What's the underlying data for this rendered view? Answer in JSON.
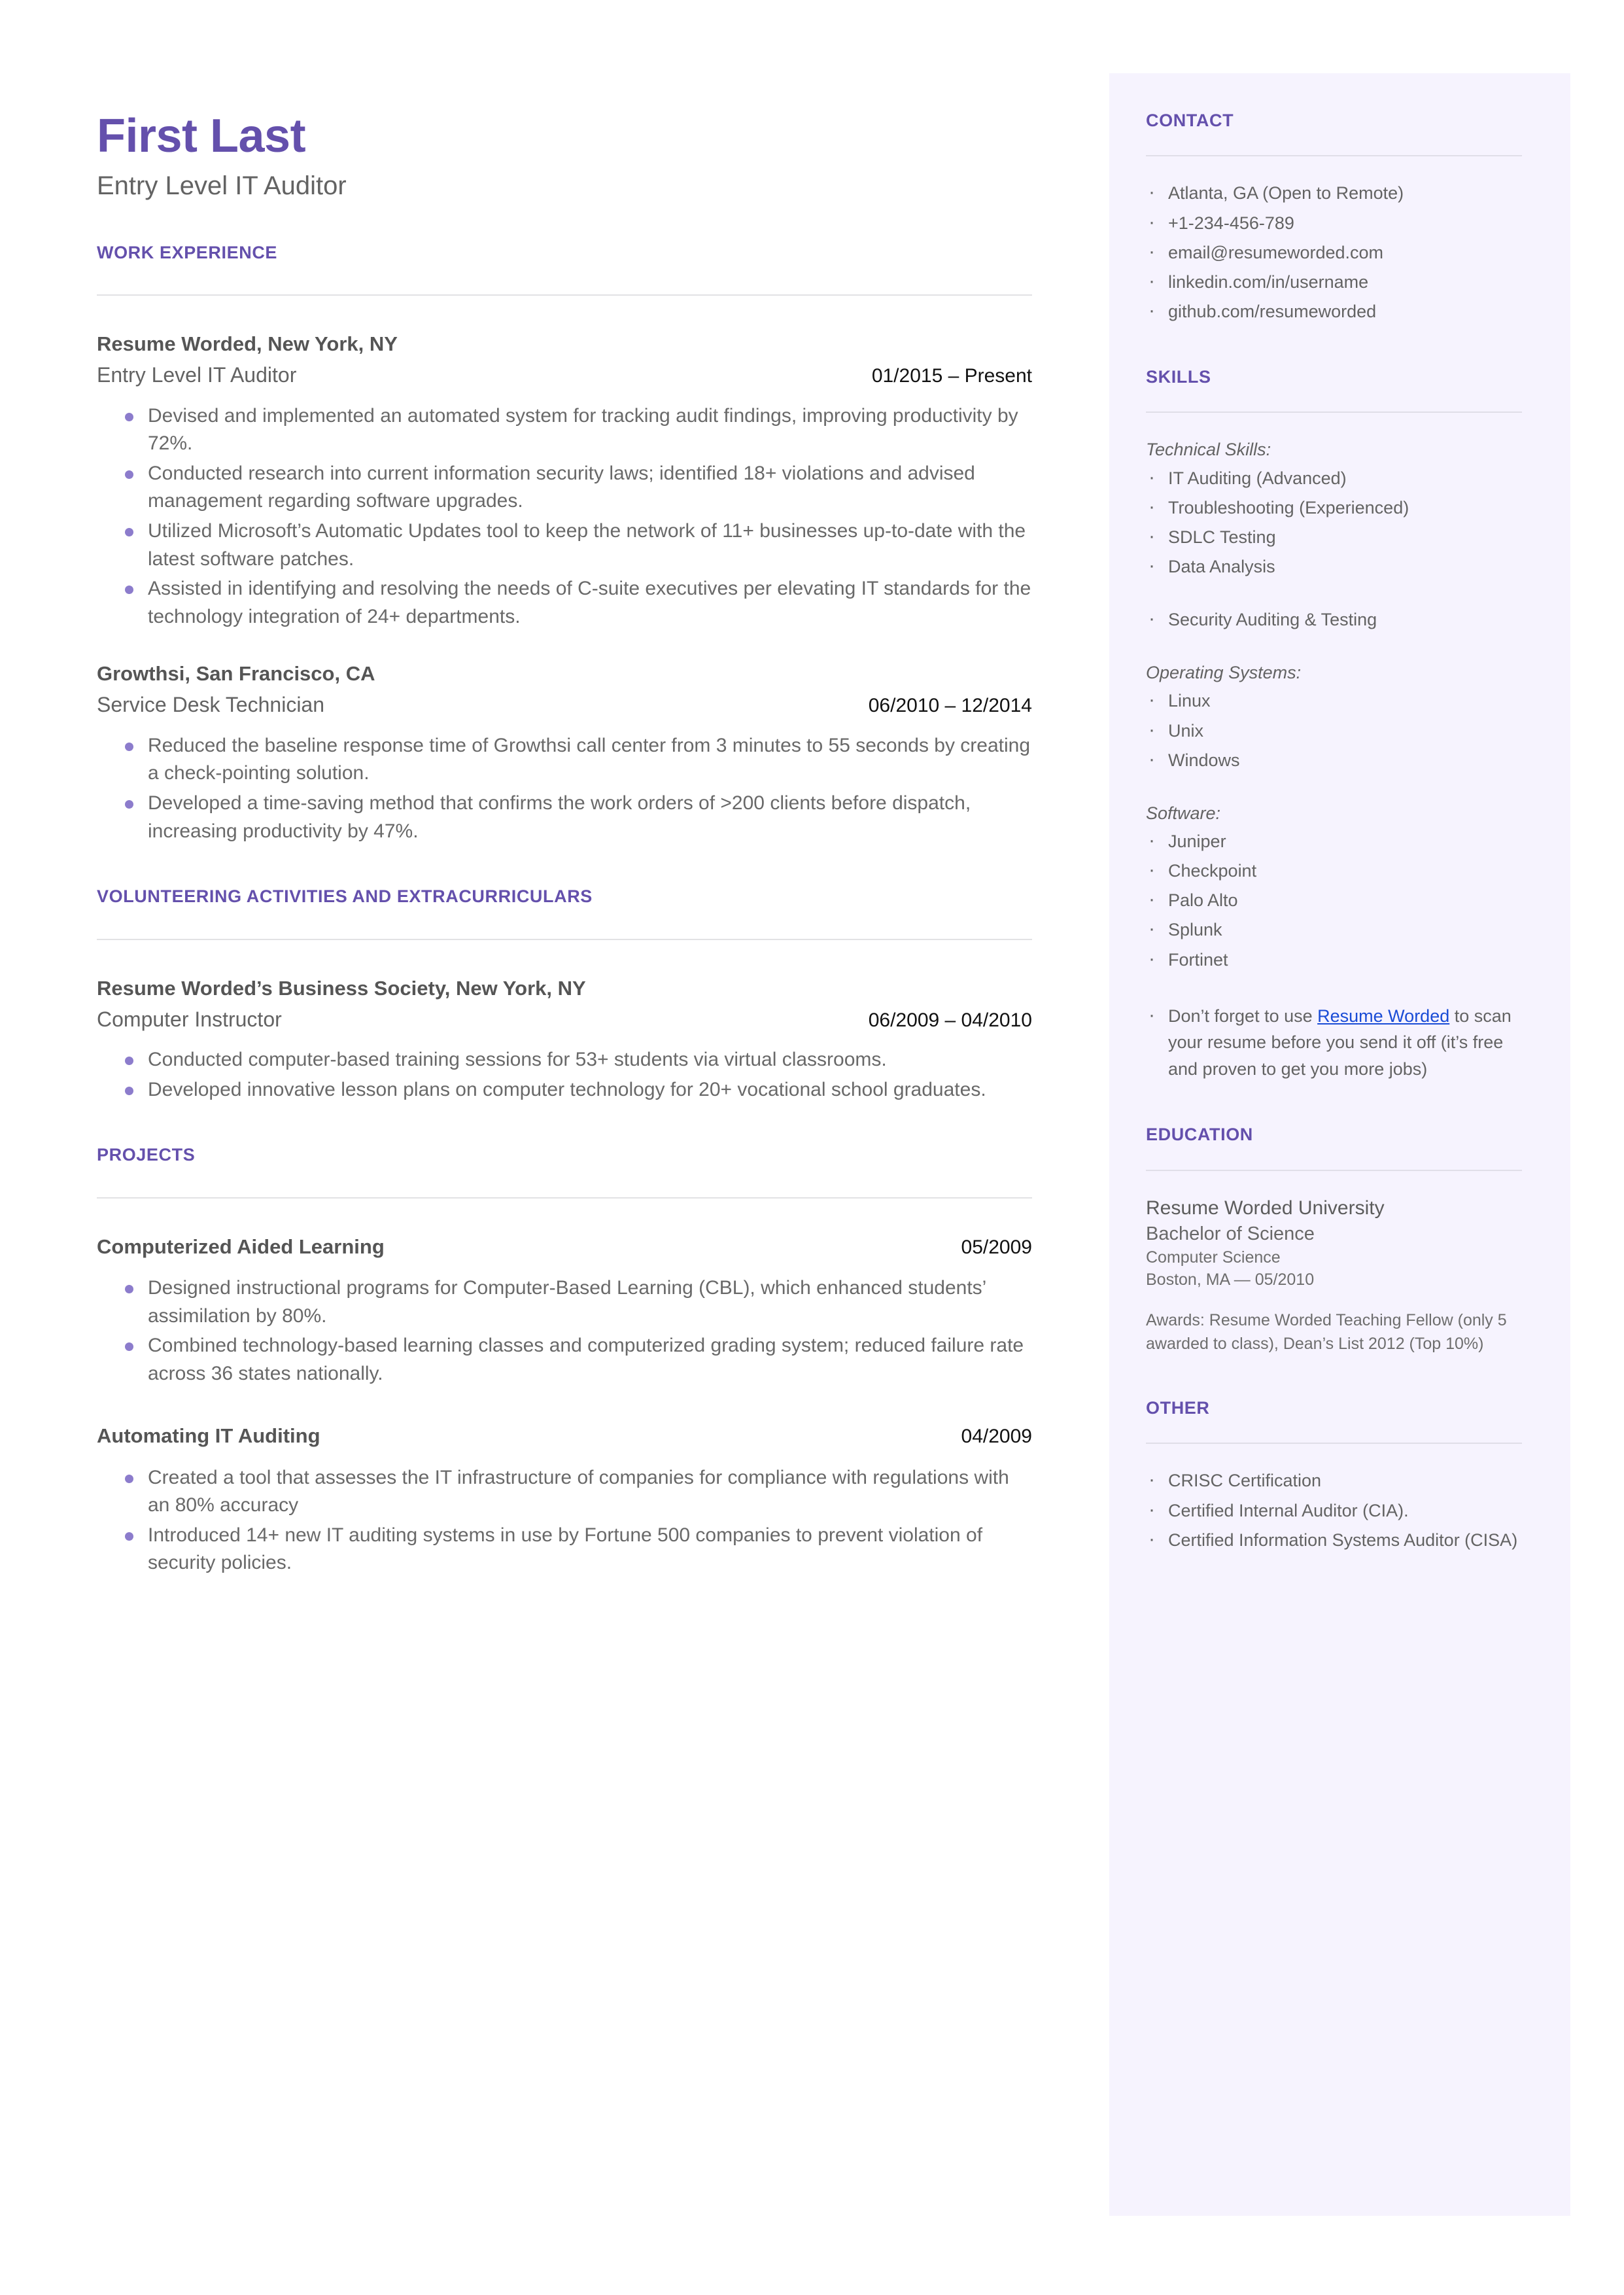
{
  "colors": {
    "accent_purple": "#6450ac",
    "bullet_purple": "#8c7ccc",
    "sidebar_bg": "#f6f3fe",
    "body_text": "#696969",
    "link_blue": "#1a4cd6"
  },
  "header": {
    "name": "First Last",
    "headline": "Entry Level IT Auditor"
  },
  "sections": {
    "work_experience": {
      "title": "WORK EXPERIENCE",
      "entries": [
        {
          "org": "Resume Worded, New York, NY",
          "role": "Entry Level IT Auditor",
          "dates": "01/2015 – Present",
          "bullets": [
            "Devised and implemented an automated system for tracking audit findings, improving productivity by 72%.",
            "Conducted research into current information security laws; identified 18+ violations and advised management regarding software upgrades.",
            "Utilized Microsoft’s Automatic Updates tool to keep the network of 11+ businesses up-to-date with the latest software patches.",
            "Assisted in identifying and resolving the needs of C-suite executives per elevating IT standards for the technology integration of 24+ departments."
          ]
        },
        {
          "org": "Growthsi, San Francisco, CA",
          "role": "Service Desk Technician",
          "dates": "06/2010 – 12/2014",
          "bullets": [
            "Reduced the baseline response time of Growthsi call center from 3 minutes to 55 seconds by creating a check-pointing solution.",
            "Developed a time-saving method that confirms the work orders of >200 clients before dispatch, increasing productivity by 47%."
          ]
        }
      ]
    },
    "volunteering": {
      "title": "VOLUNTEERING ACTIVITIES AND EXTRACURRICULARS",
      "entries": [
        {
          "org": "Resume Worded’s Business Society, New York, NY",
          "role": "Computer Instructor",
          "dates": "06/2009 – 04/2010",
          "bullets": [
            "Conducted computer-based training sessions for 53+ students via virtual classrooms.",
            "Developed innovative lesson plans on computer technology for 20+ vocational school graduates."
          ]
        }
      ]
    },
    "projects": {
      "title": "PROJECTS",
      "entries": [
        {
          "title": "Computerized Aided Learning",
          "date": "05/2009",
          "bullets": [
            "Designed instructional programs for Computer-Based Learning (CBL), which enhanced students’ assimilation by 80%.",
            "Combined technology-based learning classes and computerized grading system; reduced failure rate across 36 states nationally."
          ]
        },
        {
          "title": "Automating IT Auditing",
          "date": "04/2009",
          "bullets": [
            "Created a tool that assesses the IT infrastructure of companies for compliance with regulations with an 80% accuracy",
            "Introduced 14+ new IT auditing systems in use by Fortune 500 companies to prevent violation of security policies."
          ]
        }
      ]
    }
  },
  "sidebar": {
    "contact": {
      "title": "CONTACT",
      "items": [
        "Atlanta, GA (Open to Remote)",
        "+1-234-456-789",
        "email@resumeworded.com",
        "linkedin.com/in/username",
        "github.com/resumeworded"
      ]
    },
    "skills": {
      "title": "SKILLS",
      "groups": [
        {
          "label": "Technical Skills:",
          "items": [
            "IT Auditing (Advanced)",
            "Troubleshooting (Experienced)",
            "SDLC Testing",
            "Data Analysis"
          ]
        },
        {
          "label": "",
          "items": [
            "Security Auditing & Testing"
          ]
        },
        {
          "label": "Operating Systems:",
          "items": [
            "Linux",
            "Unix",
            "Windows"
          ]
        },
        {
          "label": "Software:",
          "items": [
            "Juniper",
            "Checkpoint",
            "Palo Alto",
            "Splunk",
            "Fortinet"
          ]
        }
      ],
      "promo": {
        "before": "Don’t forget to use ",
        "link": "Resume Worded",
        "after": " to scan your resume before you send it off (it’s free and proven to get you more jobs)"
      }
    },
    "education": {
      "title": "EDUCATION",
      "school": "Resume Worded University",
      "degree": "Bachelor of Science",
      "field": "Computer Science",
      "location_date": "Boston, MA — 05/2010",
      "awards": "Awards: Resume Worded Teaching Fellow (only 5 awarded to class), Dean’s List 2012 (Top 10%)"
    },
    "other": {
      "title": "OTHER",
      "items": [
        "CRISC Certification",
        "Certified Internal Auditor (CIA).",
        "Certified Information Systems Auditor (CISA)"
      ]
    }
  }
}
